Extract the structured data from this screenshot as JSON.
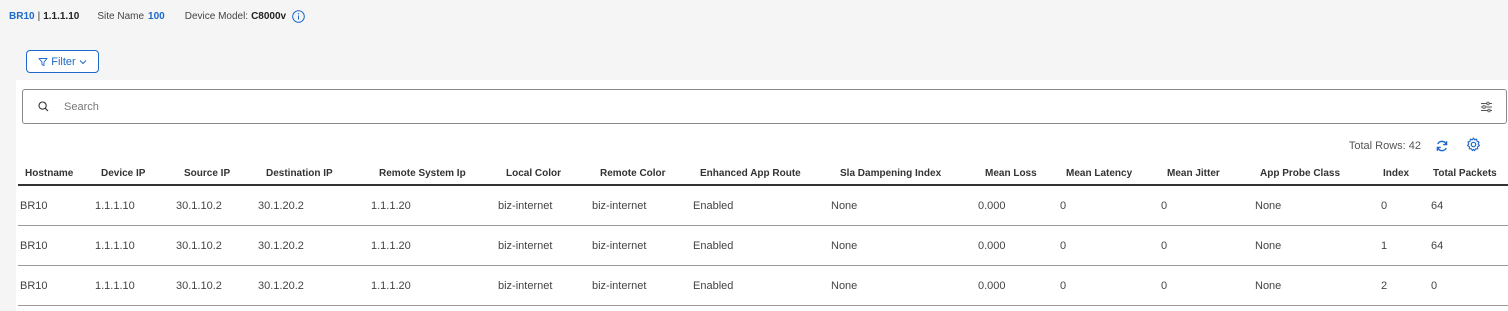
{
  "device": {
    "name": "BR10",
    "ip": "1.1.1.10",
    "site_label": "Site Name",
    "site_value": "100",
    "model_label": "Device Model:",
    "model_value": "C8000v"
  },
  "filter": {
    "label": "Filter"
  },
  "search": {
    "placeholder": "Search"
  },
  "table_info": {
    "total_rows": "Total Rows: 42"
  },
  "table": {
    "columns": [
      "Hostname",
      "Device IP",
      "Source IP",
      "Destination IP",
      "Remote System Ip",
      "Local Color",
      "Remote Color",
      "Enhanced App Route",
      "Sla Dampening Index",
      "Mean Loss",
      "Mean Latency",
      "Mean Jitter",
      "App Probe Class",
      "Index",
      "Total Packets"
    ],
    "rows": [
      [
        "BR10",
        "1.1.1.10",
        "30.1.10.2",
        "30.1.20.2",
        "1.1.1.20",
        "biz-internet",
        "biz-internet",
        "Enabled",
        "None",
        "0.000",
        "0",
        "0",
        "None",
        "0",
        "64"
      ],
      [
        "BR10",
        "1.1.1.10",
        "30.1.10.2",
        "30.1.20.2",
        "1.1.1.20",
        "biz-internet",
        "biz-internet",
        "Enabled",
        "None",
        "0.000",
        "0",
        "0",
        "None",
        "1",
        "64"
      ],
      [
        "BR10",
        "1.1.1.10",
        "30.1.10.2",
        "30.1.20.2",
        "1.1.1.20",
        "biz-internet",
        "biz-internet",
        "Enabled",
        "None",
        "0.000",
        "0",
        "0",
        "None",
        "2",
        "0"
      ]
    ]
  },
  "icons": {
    "info": "info-icon",
    "filter": "filter-icon",
    "chevron": "chevron-down-icon",
    "search": "search-icon",
    "tune": "tune-icon",
    "refresh": "refresh-icon",
    "settings": "gear-icon"
  },
  "colors": {
    "accent": "#1d69cc"
  }
}
